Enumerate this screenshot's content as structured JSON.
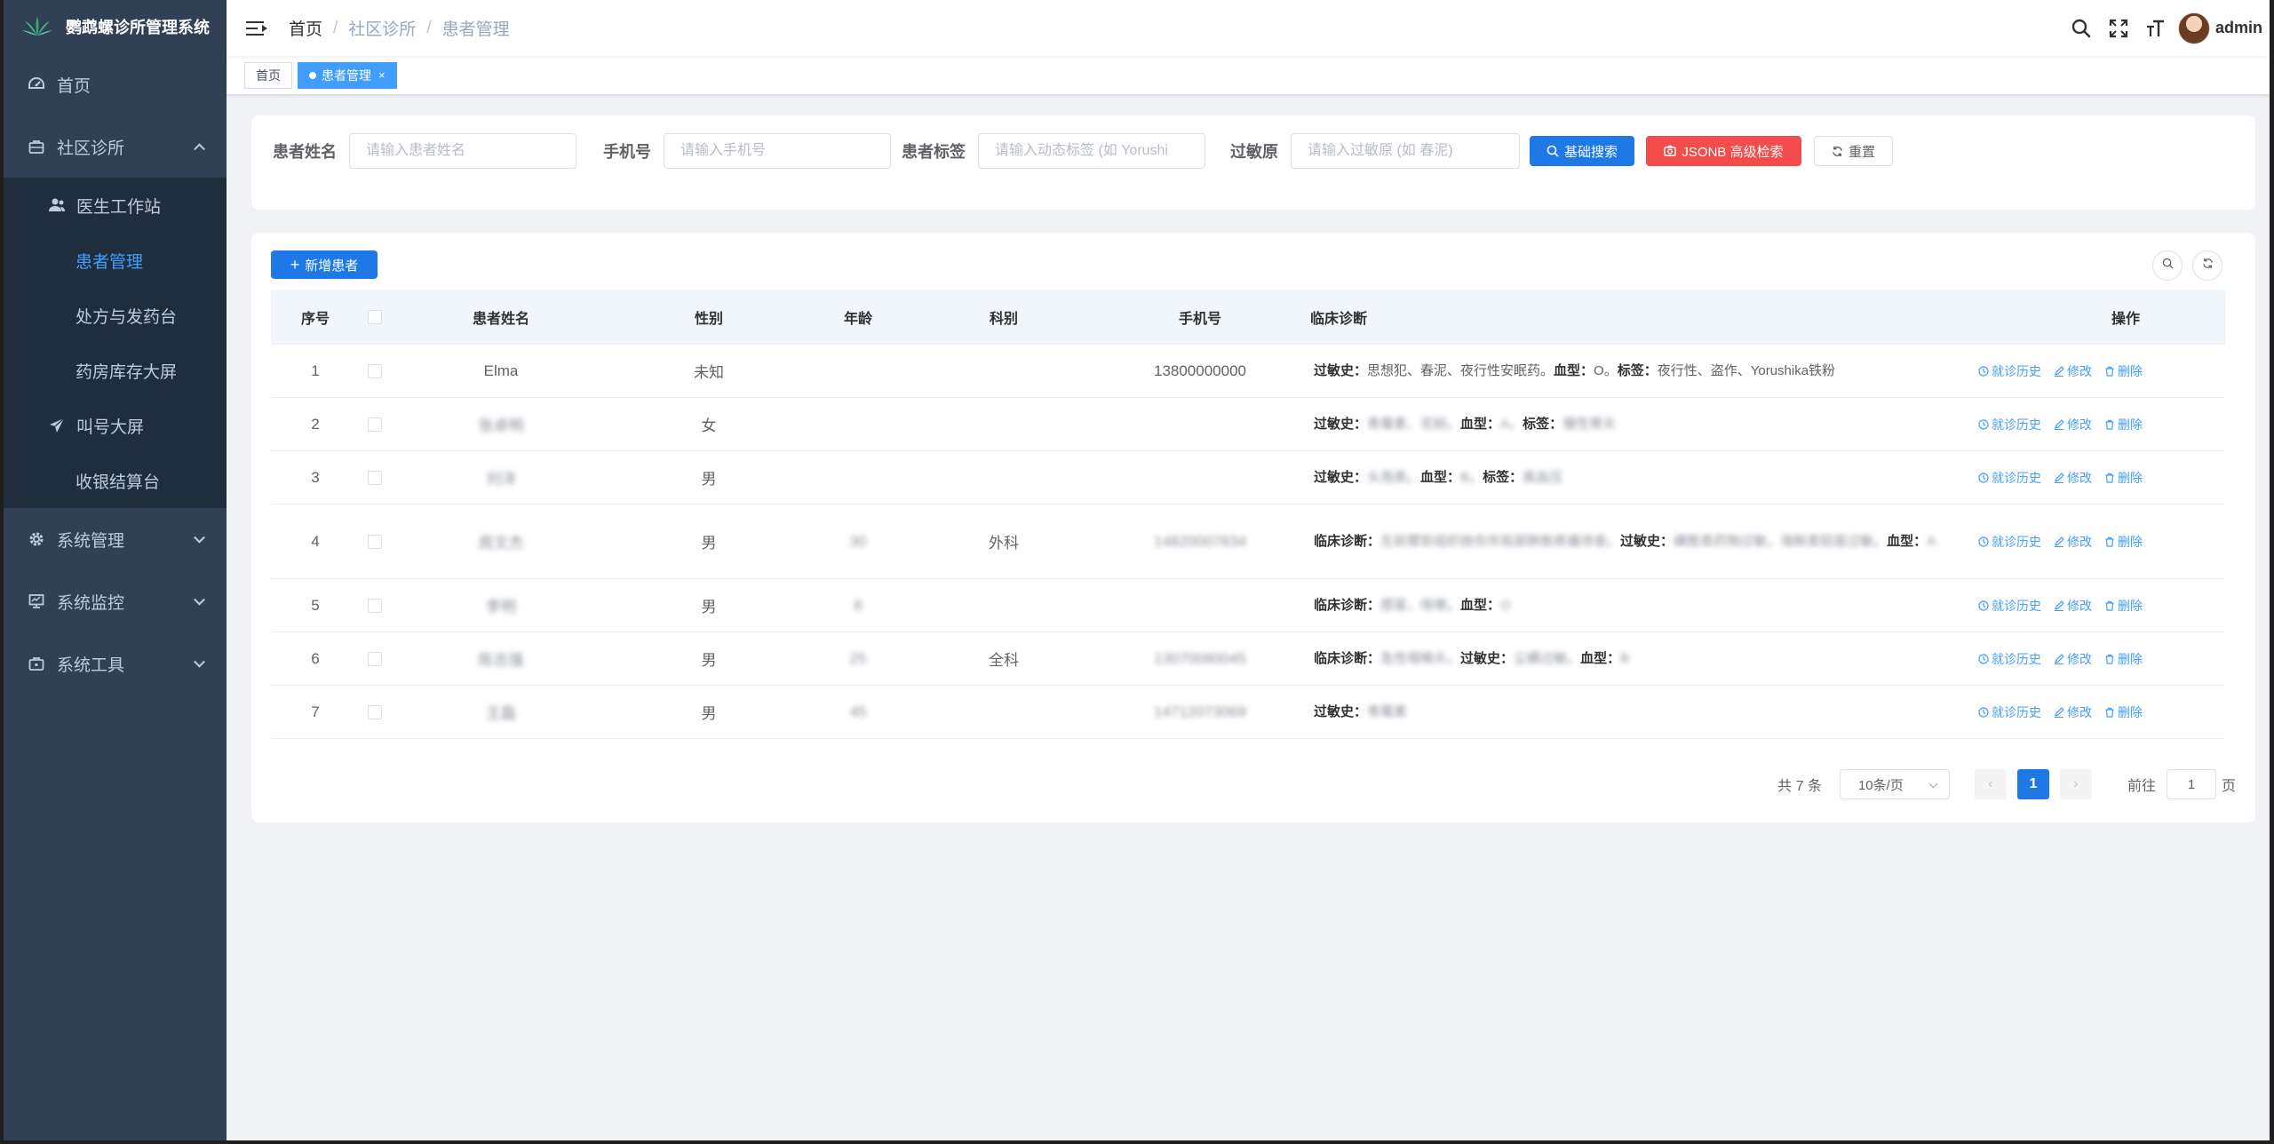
{
  "app": {
    "title": "鹦鹉螺诊所管理系统",
    "username": "admin"
  },
  "sidebar": {
    "items": [
      {
        "label": "首页",
        "icon": "dashboard-icon"
      },
      {
        "label": "社区诊所",
        "icon": "clinic-icon",
        "expanded": true
      },
      {
        "label": "系统管理",
        "icon": "gear-icon"
      },
      {
        "label": "系统监控",
        "icon": "monitor-icon"
      },
      {
        "label": "系统工具",
        "icon": "toolbox-icon"
      }
    ],
    "sub": {
      "doctor": "医生工作站",
      "patients": "患者管理",
      "prescription": "处方与发药台",
      "pharmacy": "药房库存大屏",
      "callscreen": "叫号大屏",
      "cashier": "收银结算台"
    }
  },
  "breadcrumb": [
    "首页",
    "社区诊所",
    "患者管理"
  ],
  "tags": {
    "home": "首页",
    "active": "患者管理",
    "close": "×"
  },
  "search": {
    "name_label": "患者姓名",
    "name_placeholder": "请输入患者姓名",
    "phone_label": "手机号",
    "phone_placeholder": "请输入手机号",
    "tag_label": "患者标签",
    "tag_placeholder": "请输入动态标签 (如 Yorushi",
    "allergy_label": "过敏原",
    "allergy_placeholder": "请输入过敏原 (如 春泥)",
    "basic_btn": "基础搜索",
    "jsonb_btn": "JSONB 高级检索",
    "reset_btn": "重置"
  },
  "toolbar": {
    "add_label": "新增患者"
  },
  "table": {
    "headers": {
      "no": "序号",
      "name": "患者姓名",
      "sex": "性别",
      "age": "年龄",
      "dept": "科别",
      "phone": "手机号",
      "diag": "临床诊断",
      "ops": "操作"
    },
    "rows": [
      {
        "no": "1",
        "name": "Elma",
        "sex": "未知",
        "age": "",
        "dept": "",
        "phone": "13800000000",
        "diag": [
          {
            "k": "过敏史：",
            "v": "思想犯、春泥、夜行性安眠药。"
          },
          {
            "k": "血型：",
            "v": "O。"
          },
          {
            "k": "标签：",
            "v": "夜行性、盗作、Yorushika铁粉"
          }
        ],
        "blur": false
      },
      {
        "no": "2",
        "name": "张卓明",
        "sex": "女",
        "age": "",
        "dept": "",
        "phone": "",
        "diag": [
          {
            "k": "过敏史：",
            "v": "青霉素、花粉。"
          },
          {
            "k": "血型：",
            "v": "A。"
          },
          {
            "k": "标签：",
            "v": "慢性胃炎"
          }
        ],
        "blur": true
      },
      {
        "no": "3",
        "name": "刘洋",
        "sex": "男",
        "age": "",
        "dept": "",
        "phone": "",
        "diag": [
          {
            "k": "过敏史：",
            "v": "头孢类。"
          },
          {
            "k": "血型：",
            "v": "B。"
          },
          {
            "k": "标签：",
            "v": "高血压"
          }
        ],
        "blur": true
      },
      {
        "no": "4",
        "name": "周文杰",
        "sex": "男",
        "age": "30",
        "dept": "外科",
        "phone": "14820007834",
        "diag": [
          {
            "k": "临床诊断：",
            "v": "左前臂软组织挫伤伴局部肿胀疼痛待查。"
          },
          {
            "k": "过敏史：",
            "v": "磺胺类药物过敏，海鲜类轻度过敏。"
          },
          {
            "k": "血型：",
            "v": "A"
          }
        ],
        "blur": true
      },
      {
        "no": "5",
        "name": "李明",
        "sex": "男",
        "age": "8",
        "dept": "",
        "phone": "",
        "diag": [
          {
            "k": "临床诊断：",
            "v": "感冒，咳嗽。"
          },
          {
            "k": "血型：",
            "v": "O"
          }
        ],
        "blur": true
      },
      {
        "no": "6",
        "name": "陈志强",
        "sex": "男",
        "age": "25",
        "dept": "全科",
        "phone": "13070080045",
        "diag": [
          {
            "k": "临床诊断：",
            "v": "急性咽喉炎。"
          },
          {
            "k": "过敏史：",
            "v": "尘螨过敏。"
          },
          {
            "k": "血型：",
            "v": "B"
          }
        ],
        "blur": true
      },
      {
        "no": "7",
        "name": "王磊",
        "sex": "男",
        "age": "45",
        "dept": "",
        "phone": "14712073069",
        "diag": [
          {
            "k": "过敏史：",
            "v": "青霉素"
          }
        ],
        "blur": true
      }
    ],
    "ops": {
      "history": "就诊历史",
      "edit": "修改",
      "delete": "删除"
    }
  },
  "pagination": {
    "total": "共 7 条",
    "page_size": "10条/页",
    "prev": "‹",
    "current": "1",
    "next": "›",
    "goto_label": "前往",
    "goto_value": "1",
    "page_suffix": "页"
  },
  "colors": {
    "sidebar_bg": "#304156",
    "submenu_bg": "#1f2d3d",
    "accent": "#409eff",
    "primary_btn": "#1e79e6",
    "danger_btn": "#f44b4b"
  }
}
